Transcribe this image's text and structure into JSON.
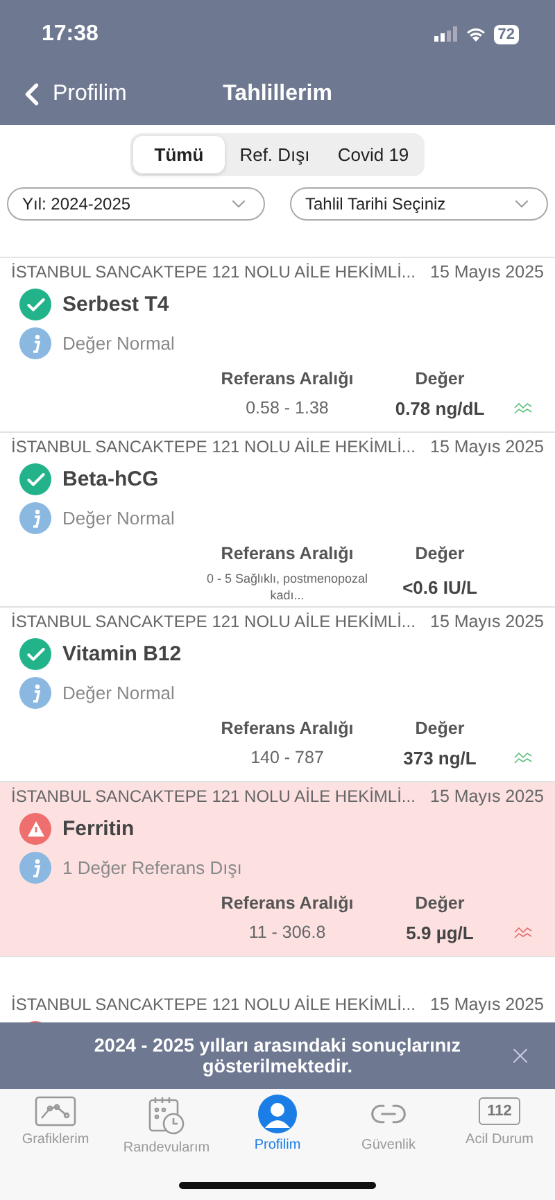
{
  "status_bar": {
    "time": "17:38",
    "battery": "72"
  },
  "nav": {
    "back": "Profilim",
    "title": "Tahlillerim"
  },
  "segments": [
    {
      "label": "Tümü",
      "selected": true
    },
    {
      "label": "Ref. Dışı",
      "selected": false
    },
    {
      "label": "Covid 19",
      "selected": false
    }
  ],
  "filters": [
    {
      "value": "Yıl: 2024-2025"
    },
    {
      "value": "Tahlil Tarihi Seçiniz"
    }
  ],
  "results": [
    {
      "institution": "İSTANBUL SANCAKTEPE 121  NOLU AİLE HEKİMLİ...",
      "date": "15 Mayıs 2025",
      "kind": "normal",
      "name": "Serbest T4",
      "note": "Değer Normal",
      "range_label": "Referans Aralığı",
      "value_label": "Değer",
      "range": "0.58 - 1.38",
      "value": "0.78 ng/dL",
      "trend": true
    },
    {
      "institution": "İSTANBUL SANCAKTEPE 121  NOLU AİLE HEKİMLİ...",
      "date": "15 Mayıs 2025",
      "kind": "normal",
      "name": "Beta-hCG",
      "note": "Değer Normal",
      "range_label": "Referans Aralığı",
      "value_label": "Değer",
      "range": "0 - 5 Sağlıklı, postmenopozal kadı...",
      "value": "<0.6 IU/L",
      "trend": false
    },
    {
      "institution": "İSTANBUL SANCAKTEPE 121  NOLU AİLE HEKİMLİ...",
      "date": "15 Mayıs 2025",
      "kind": "normal",
      "name": "Vitamin B12",
      "note": "Değer Normal",
      "range_label": "Referans Aralığı",
      "value_label": "Değer",
      "range": "140 - 787",
      "value": "373 ng/L",
      "trend": true
    },
    {
      "institution": "İSTANBUL SANCAKTEPE 121  NOLU AİLE HEKİMLİ...",
      "date": "15 Mayıs 2025",
      "kind": "abnormal",
      "name": "Ferritin",
      "note": "1 Değer Referans Dışı",
      "range_label": "Referans Aralığı",
      "value_label": "Değer",
      "range": "11 - 306.8",
      "value": "5.9 µg/L",
      "trend": true
    },
    {
      "institution": "İSTANBUL SANCAKTEPE 121  NOLU AİLE HEKİMLİ...",
      "date": "15 Mayıs 2025",
      "kind": "abnormal"
    }
  ],
  "banner": {
    "text": "2024 - 2025 yılları arasındaki sonuçlarınız gösterilmektedir."
  },
  "tab_bar": [
    {
      "kind": "chart",
      "label": "Grafiklerim",
      "selected": false
    },
    {
      "kind": "calendar",
      "label": "Randevularım",
      "selected": false
    },
    {
      "kind": "profile",
      "label": "Profilim",
      "selected": true
    },
    {
      "kind": "link",
      "label": "Güvenlik",
      "selected": false
    },
    {
      "kind": "emergency",
      "label": "Acil Durum",
      "badge": "112",
      "selected": false
    }
  ]
}
